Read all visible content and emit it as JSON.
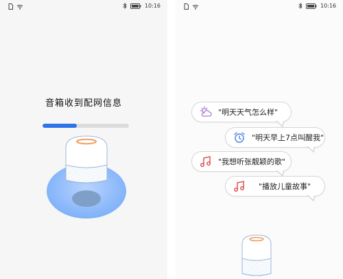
{
  "left_screen": {
    "status_time": "10:16",
    "title": "音箱收到配网信息",
    "progress": 0.4
  },
  "right_screen": {
    "status_time": "10:16",
    "bubbles": [
      {
        "icon": "cloud-sun-icon",
        "text": "\"明天天气怎么样\""
      },
      {
        "icon": "alarm-clock-icon",
        "text": "\"明天早上7点叫醒我\""
      },
      {
        "icon": "music-note-icon",
        "text": "\"我想听张靓颖的歌\""
      },
      {
        "icon": "music-note-icon",
        "text": "\"播放儿童故事\""
      }
    ]
  },
  "colors": {
    "accent": "#2f73e8",
    "speaker_light": "#f0a060",
    "icon_purple": "#a97bd6",
    "icon_blue": "#4a7fe0",
    "icon_red": "#e05050"
  }
}
